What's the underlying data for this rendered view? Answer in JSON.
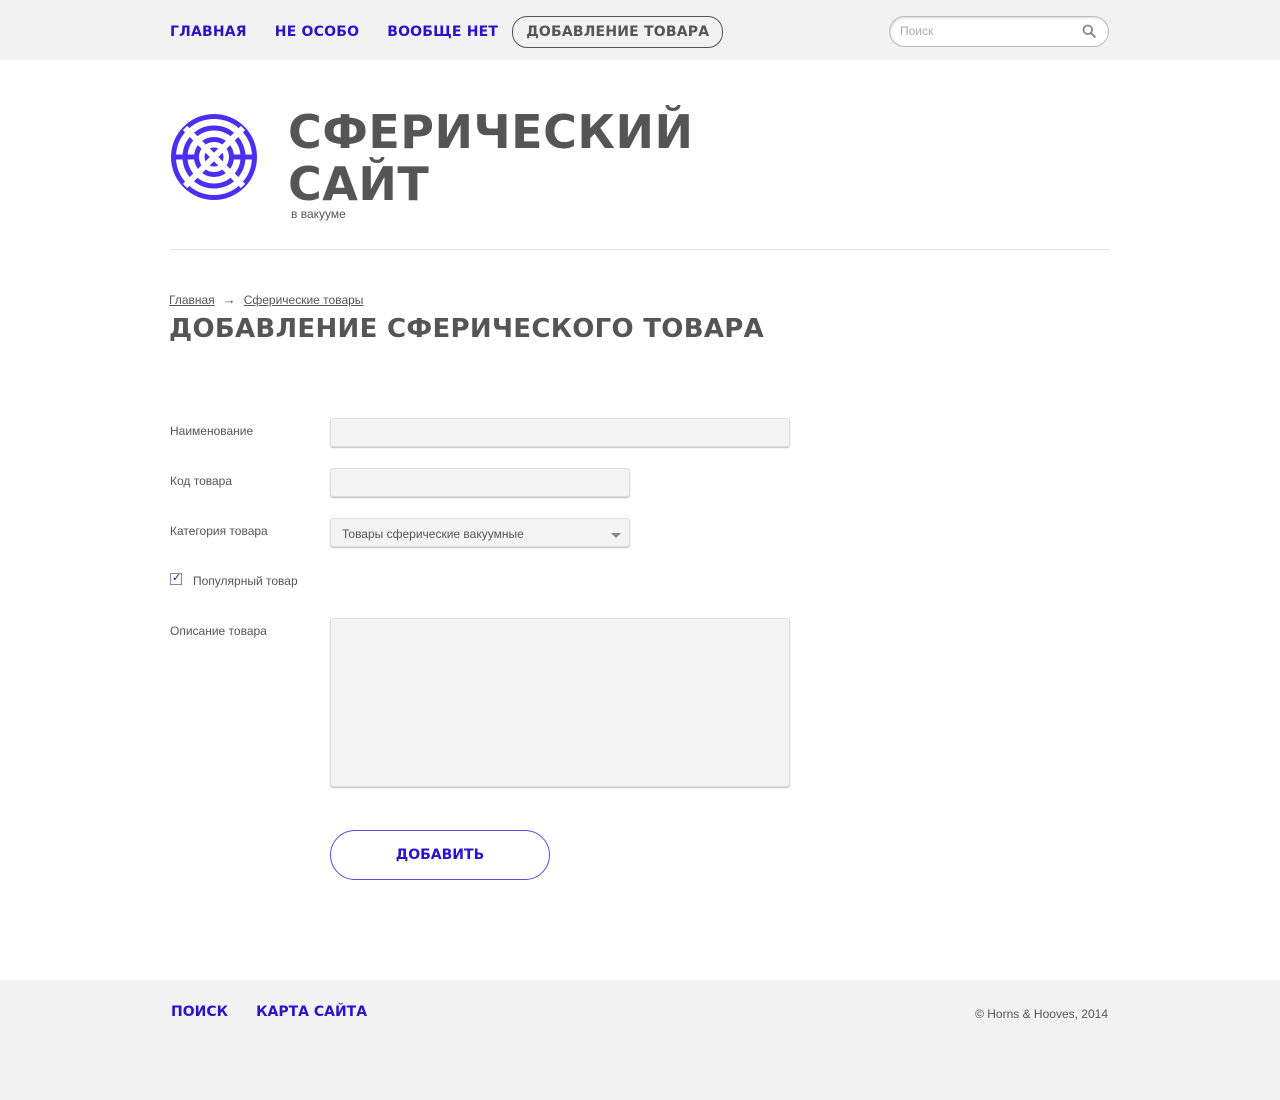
{
  "nav": {
    "items": [
      {
        "label": "Главная"
      },
      {
        "label": "Не особо"
      },
      {
        "label": "Вообще нет"
      },
      {
        "label": "Добавление товара",
        "active": true
      }
    ]
  },
  "search": {
    "placeholder": "Поиск",
    "icon": "search-icon"
  },
  "header": {
    "logo": "concentric-sphere-logo",
    "title": "Сферический сайт",
    "subtitle": "в вакууме"
  },
  "breadcrumb": {
    "items": [
      "Главная",
      "Сферические товары"
    ],
    "separator": "→"
  },
  "page_title": "Добавление сферического товара",
  "form": {
    "name_label": "Наименование",
    "name_value": "",
    "code_label": "Код товара",
    "code_value": "",
    "category_label": "Категория товара",
    "category_value": "Товары сферические вакуумные",
    "popular_label": "Популярный товар",
    "popular_checked": true,
    "description_label": "Описание товара",
    "description_value": "",
    "submit_label": "Добавить"
  },
  "footer": {
    "links": [
      "Поиск",
      "Карта сайта"
    ],
    "copyright": "© Horns & Hooves, 2014"
  },
  "colors": {
    "accent": "#2a13c9",
    "logo": "#4a2ff0",
    "text": "#555555",
    "background": "#f2f2f2"
  }
}
